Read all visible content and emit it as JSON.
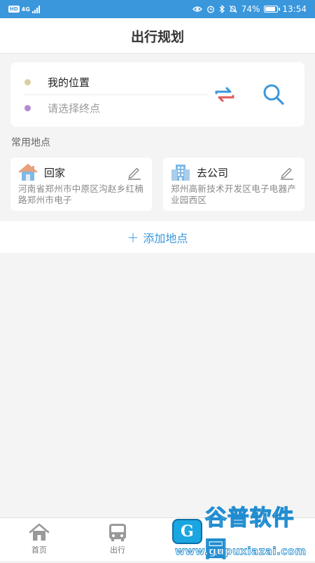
{
  "status_bar": {
    "network_chip": "HD",
    "network_type": "4G",
    "battery": "74%",
    "battery_level": 0.74,
    "time": "13:54"
  },
  "header": {
    "title": "出行规划"
  },
  "route": {
    "start": "我的位置",
    "end_placeholder": "请选择终点",
    "start_dot_color": "#d9cfa3",
    "end_dot_color": "#b58ad4"
  },
  "common_places": {
    "section_label": "常用地点",
    "home": {
      "name": "回家",
      "address": "河南省郑州市中原区沟赵乡红楠路郑州市电子"
    },
    "work": {
      "name": "去公司",
      "address": "郑州高新技术开发区电子电器产业园西区"
    }
  },
  "add_place": {
    "label": "添加地点",
    "plus": "+"
  },
  "tabs": [
    {
      "label": "首页",
      "icon": "house-icon"
    },
    {
      "label": "出行",
      "icon": "bus-icon"
    }
  ],
  "watermark": {
    "logo": "G",
    "title": "谷普软件园",
    "url": "www.gupuxiazai.com"
  },
  "colors": {
    "accent": "#3b97dc",
    "swap_red": "#e05a5a",
    "background": "#f4f4f4"
  }
}
